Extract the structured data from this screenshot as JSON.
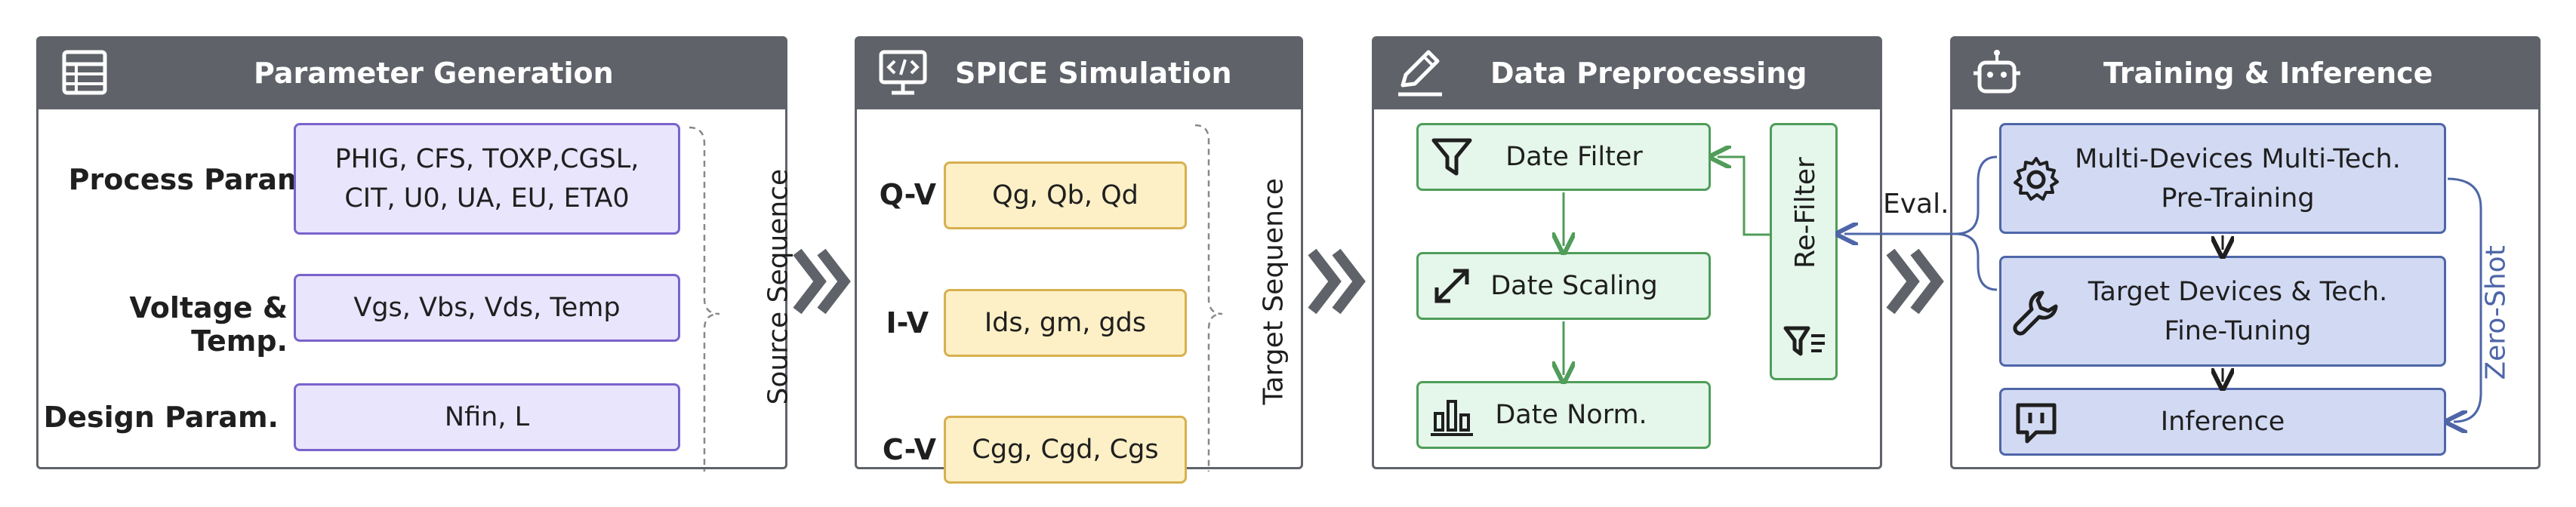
{
  "panels": {
    "param_gen": {
      "title": "Parameter Generation",
      "rows": [
        {
          "label": "Process Param.",
          "value": "PHIG, CFS, TOXP,CGSL,\nCIT, U0, UA, EU, ETA0"
        },
        {
          "label": "Voltage & Temp.",
          "value": "Vgs, Vbs, Vds, Temp"
        },
        {
          "label": "Design Param.",
          "value": "Nfin, L"
        }
      ],
      "brace_label": "Source  Sequence"
    },
    "spice": {
      "title": "SPICE Simulation",
      "rows": [
        {
          "label": "Q-V",
          "value": "Qg, Qb, Qd"
        },
        {
          "label": "I-V",
          "value": "Ids, gm, gds"
        },
        {
          "label": "C-V",
          "value": "Cgg,  Cgd, Cgs"
        }
      ],
      "brace_label": "Target Sequence"
    },
    "preproc": {
      "title": "Data Preprocessing",
      "steps": [
        "Date Filter",
        "Date Scaling",
        "Date Norm."
      ],
      "refilter": "Re-Filter"
    },
    "training": {
      "title": "Training & Inference",
      "steps": [
        "Multi-Devices Multi-Tech.\nPre-Training",
        "Target Devices & Tech.\nFine-Tuning",
        "Inference"
      ],
      "zero_shot": "Zero-Shot"
    }
  },
  "eval_label": "Eval.",
  "colors": {
    "header": "#5f6369",
    "purple_fill": "#e9e5fc",
    "purple_border": "#7a63cc",
    "yellow_fill": "#fdf0c6",
    "yellow_border": "#d7b04f",
    "green_fill": "#e5f6ea",
    "green_border": "#4f9d59",
    "blue_fill": "#d2daf3",
    "blue_border": "#4e66a8"
  },
  "icons": [
    "table-icon",
    "monitor-code-icon",
    "pencil-icon",
    "robot-icon",
    "filter-icon",
    "expand-arrows-icon",
    "bar-chart-icon",
    "gear-icon",
    "wrench-icon",
    "chat-icon",
    "filter-outline-icon"
  ]
}
